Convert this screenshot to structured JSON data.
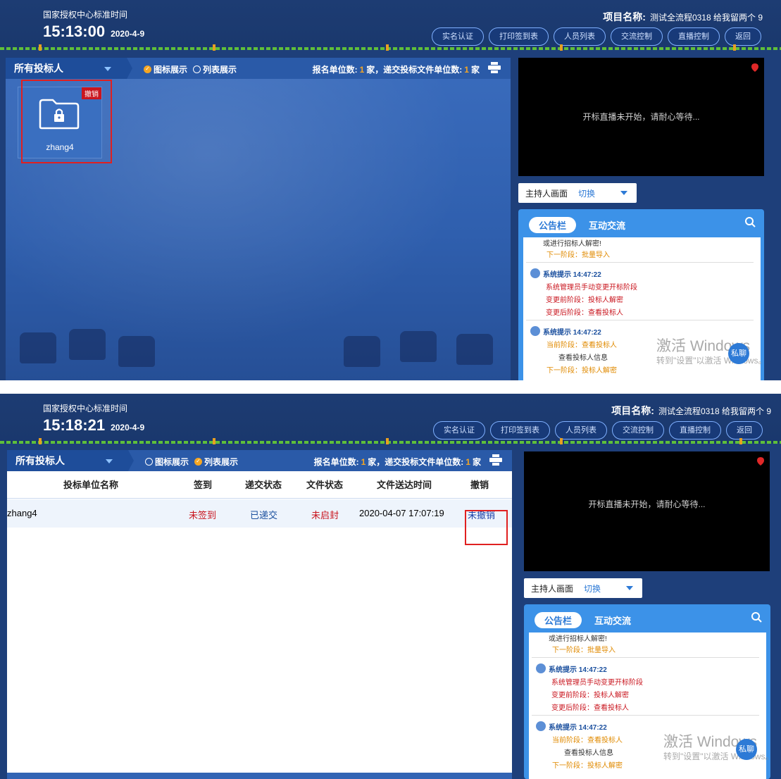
{
  "header": {
    "time_label": "国家授权中心标准时间",
    "project_label": "项目名称:",
    "project_name": "测试全流程0318 给我留两个 9",
    "buttons": [
      "实名认证",
      "打印签到表",
      "人员列表",
      "交流控制",
      "直播控制",
      "返回"
    ]
  },
  "panels": [
    {
      "time": "15:13:00",
      "date": "2020-4-9",
      "mode": "icon"
    },
    {
      "time": "15:18:21",
      "date": "2020-4-9",
      "mode": "list"
    }
  ],
  "toolbar": {
    "all_bidders": "所有投标人",
    "icon_view": "图标展示",
    "list_view": "列表展示",
    "count_prefix": "报名单位数:",
    "count_mid": "家，递交投标文件单位数:",
    "count_suffix": "家",
    "registered": "1",
    "submitted": "1"
  },
  "folder": {
    "name": "zhang4",
    "tag": "撤销"
  },
  "table": {
    "headers": [
      "投标单位名称",
      "签到",
      "递交状态",
      "文件状态",
      "文件送达时间",
      "撤销"
    ],
    "rows": [
      {
        "name": "zhang4",
        "sign": "未签到",
        "submit": "已递交",
        "file": "未启封",
        "time": "2020-04-07 17:07:19",
        "revoke": "未撤销"
      }
    ]
  },
  "video": {
    "message": "开标直播未开始，请耐心等待..."
  },
  "host": {
    "label": "主持人画面",
    "switch": "切换"
  },
  "notice": {
    "tab_active": "公告栏",
    "tab_other": "互动交流",
    "line_top1": "或进行招标人解密!",
    "line_top2": "下一阶段：批量导入",
    "sys1_title": "系统提示 14:47:22",
    "sys1_l1": "系统管理员手动变更开标阶段",
    "sys1_l2": "变更前阶段：投标人解密",
    "sys1_l3": "变更后阶段：查看投标人",
    "sys2_title": "系统提示 14:47:22",
    "sys2_l1": "当前阶段：查看投标人",
    "sys2_l2": "查看投标人信息",
    "sys2_l3": "下一阶段：投标人解密"
  },
  "watermark": {
    "line1": "激活 Windows",
    "line2": "转到\"设置\"以激活 Windows。"
  },
  "chat_button": "私聊",
  "colors": {
    "accent": "#f5a623",
    "alert_red": "#c9151e",
    "link_blue": "#2d7ad6",
    "header_bg": "#1d3c73"
  }
}
